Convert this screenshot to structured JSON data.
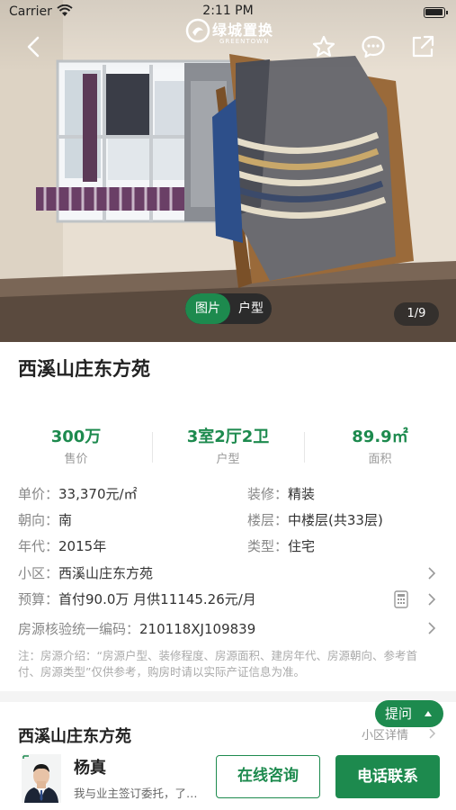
{
  "status_bar": {
    "carrier": "Carrier",
    "time": "2:11 PM"
  },
  "brand": {
    "name_cn": "绿城置换",
    "name_en": "GREENTOWN"
  },
  "gallery": {
    "toggle": [
      "图片",
      "户型"
    ],
    "counter": "1/9"
  },
  "listing": {
    "title": "西溪山庄东方苑",
    "stats": [
      {
        "value": "300万",
        "label": "售价"
      },
      {
        "value": "3室2厅2卫",
        "label": "户型"
      },
      {
        "value": "89.9㎡",
        "label": "面积"
      }
    ],
    "details": {
      "unit_price": {
        "key": "单价：",
        "value": "33,370元/㎡"
      },
      "decoration": {
        "key": "装修：",
        "value": "精装"
      },
      "orientation": {
        "key": "朝向：",
        "value": "南"
      },
      "floor": {
        "key": "楼层：",
        "value": "中楼层(共33层)"
      },
      "year": {
        "key": "年代：",
        "value": "2015年"
      },
      "type": {
        "key": "类型：",
        "value": "住宅"
      },
      "community": {
        "key": "小区：",
        "value": "西溪山庄东方苑"
      },
      "budget": {
        "key": "预算：",
        "value": "首付90.0万 月供11145.26元/月"
      },
      "verify_code": {
        "key": "房源核验统一编码：",
        "value": "210118XJ109839"
      }
    },
    "note": "注：房源介绍：“房源户型、装修程度、房源面积、建房年代、房源朝向、参考首付、房源类型”仅供参考，购房时请以实际产证信息为准。"
  },
  "community_section": {
    "title": "西溪山庄东方苑",
    "detail_link": "小区详情"
  },
  "ask_button": "提问",
  "agent": {
    "name": "杨真",
    "description": "我与业主签订委托，了…",
    "consult_label": "在线咨询",
    "call_label": "电话联系"
  },
  "colors": {
    "brand_green": "#1d8a4e"
  }
}
